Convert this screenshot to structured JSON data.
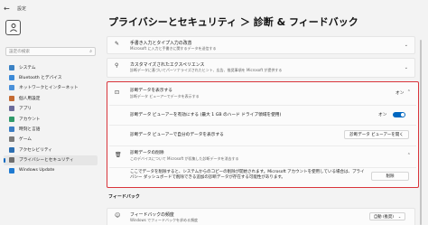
{
  "window": {
    "title": "設定"
  },
  "sidebar": {
    "search_placeholder": "設定の検索",
    "items": [
      {
        "label": "システム",
        "color": "#3b82c4"
      },
      {
        "label": "Bluetooth とデバイス",
        "color": "#3c8ad8"
      },
      {
        "label": "ネットワークとインターネット",
        "color": "#4a90d9"
      },
      {
        "label": "個人用設定",
        "color": "#c46a32"
      },
      {
        "label": "アプリ",
        "color": "#6b6b9a"
      },
      {
        "label": "アカウント",
        "color": "#2f9a6a"
      },
      {
        "label": "時刻と言語",
        "color": "#3b7dc4"
      },
      {
        "label": "ゲーム",
        "color": "#7a7a7a"
      },
      {
        "label": "アクセシビリティ",
        "color": "#2d6fb2"
      },
      {
        "label": "プライバシーとセキュリティ",
        "color": "#6e6e6e"
      },
      {
        "label": "Windows Update",
        "color": "#1f7ad1"
      }
    ]
  },
  "header": {
    "title": "プライバシーとセキュリティ ＞ 診断 & フィードバック"
  },
  "cards": [
    {
      "title": "手書き入力とタイプ入力の改善",
      "subtitle": "Microsoft に入力と手書きに関するデータを送信する"
    },
    {
      "title": "カスタマイズされたエクスペリエンス",
      "subtitle": "診断データに基づいてパーソナライズされたヒント、広告、推奨事項を Microsoft が提供する"
    }
  ],
  "diag_view": {
    "title": "診断データを表示する",
    "subtitle": "診断データ ビューアーでデータを表示する",
    "state": "オン",
    "toggle_row_label": "診断データ ビューアーを有効にする (最大 1 GB のハード ドライブ領域を使用)",
    "toggle_state": "オン",
    "open_row_label": "診断データ ビューアーで自分のデータを表示する",
    "open_button": "診断データ ビューアーを開く"
  },
  "diag_delete": {
    "title": "診断データの削除",
    "subtitle": "このデバイスについて Microsoft が収集した診断データを消去する",
    "description": "ここでデータを削除すると、システムからのコピーの削除が開始されます。Microsoft アカウントを使用している場合は、プライバシー ダッシュボードで削除できる追加の診断データが存在する可能性があります。",
    "button": "削除"
  },
  "feedback": {
    "heading": "フィードバック",
    "frequency_title": "フィードバックの頻度",
    "frequency_subtitle": "Windows でフィードバックを求める頻度",
    "frequency_value": "自動 (推奨)"
  },
  "icons": {
    "back": "back-arrow-icon",
    "search": "search-icon",
    "view": "diagnostic-view-icon",
    "delete": "trash-icon"
  },
  "colors": {
    "accent": "#0067c0",
    "highlight_border": "#d9343b"
  }
}
